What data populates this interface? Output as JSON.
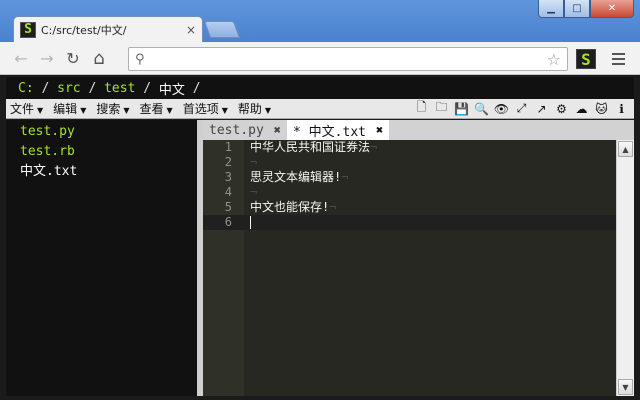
{
  "window": {
    "minimize": "▁",
    "maximize": "□",
    "close": "✕"
  },
  "browser": {
    "tab": {
      "favicon": "S",
      "title": "C:/src/test/中文/",
      "close": "×"
    },
    "nav": {
      "back": "←",
      "forward": "→",
      "reload": "↻",
      "home": "⌂"
    },
    "omnibox": {
      "value": "",
      "placeholder": "",
      "search_icon": "⚲",
      "star_icon": "☆"
    },
    "extension_label": "S"
  },
  "app": {
    "path": [
      {
        "label": "C:",
        "kind": "segment"
      },
      {
        "label": "src",
        "kind": "segment"
      },
      {
        "label": "test",
        "kind": "segment"
      },
      {
        "label": "中文",
        "kind": "current"
      }
    ],
    "path_separator": " / ",
    "menus": [
      {
        "label": "文件"
      },
      {
        "label": "编辑"
      },
      {
        "label": "搜索"
      },
      {
        "label": "查看"
      },
      {
        "label": "首选项"
      },
      {
        "label": "帮助"
      }
    ],
    "menu_caret": "▼",
    "toolbar_icons": [
      {
        "name": "new-file-icon",
        "glyph": "🗋"
      },
      {
        "name": "open-folder-icon",
        "glyph": "🗀"
      },
      {
        "name": "save-icon",
        "glyph": "💾"
      },
      {
        "name": "search-icon",
        "glyph": "🔍"
      },
      {
        "name": "eye-icon",
        "glyph": "👁"
      },
      {
        "name": "fullscreen-icon",
        "glyph": "⤢"
      },
      {
        "name": "external-link-icon",
        "glyph": "↗"
      },
      {
        "name": "settings-gear-icon",
        "glyph": "⚙"
      },
      {
        "name": "cloud-upload-icon",
        "glyph": "☁"
      },
      {
        "name": "github-icon",
        "glyph": "🐱"
      },
      {
        "name": "info-icon",
        "glyph": "ℹ"
      }
    ],
    "files": [
      {
        "name": "test.py",
        "type": "source"
      },
      {
        "name": "test.rb",
        "type": "source"
      },
      {
        "name": "中文.txt",
        "type": "text"
      }
    ],
    "editor_tabs": [
      {
        "label": "test.py",
        "close": "✖",
        "active": false
      },
      {
        "label": "* 中文.txt",
        "close": "✖",
        "active": true
      }
    ],
    "lines": [
      {
        "num": "1",
        "text": "中华人民共和国证券法"
      },
      {
        "num": "2",
        "text": ""
      },
      {
        "num": "3",
        "text": "思灵文本编辑器!"
      },
      {
        "num": "4",
        "text": ""
      },
      {
        "num": "5",
        "text": "中文也能保存!"
      },
      {
        "num": "6",
        "text": ""
      }
    ],
    "newline_marker": "¬",
    "current_line": 6,
    "scroll_up": "▲",
    "scroll_down": "▼"
  }
}
